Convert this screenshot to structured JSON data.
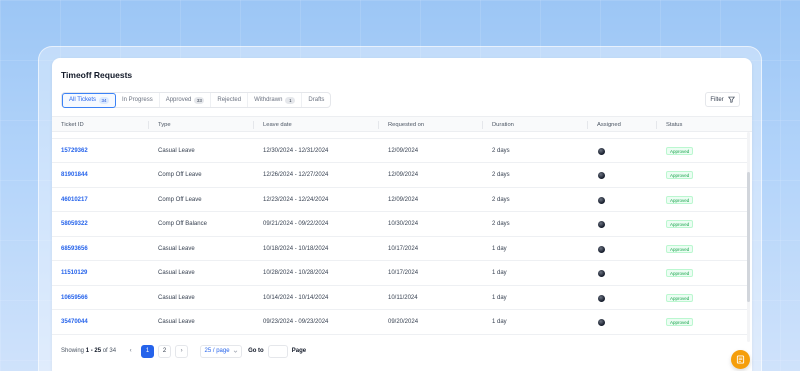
{
  "page": {
    "title": "Timeoff Requests"
  },
  "tabs": [
    {
      "label": "All Tickets",
      "count": "34",
      "active": true
    },
    {
      "label": "In Progress",
      "count": ""
    },
    {
      "label": "Approved",
      "count": "33"
    },
    {
      "label": "Rejected",
      "count": ""
    },
    {
      "label": "Withdrawn",
      "count": "1"
    },
    {
      "label": "Drafts",
      "count": ""
    }
  ],
  "filter": {
    "label": "Filter",
    "icon": "filter-icon"
  },
  "table": {
    "columns": [
      "Ticket ID",
      "Type",
      "Leave date",
      "Requested on",
      "Duration",
      "Assigned",
      "Status"
    ],
    "rows": [
      {
        "id": "15729362",
        "type": "Casual Leave",
        "leave_date": "12/30/2024 - 12/31/2024",
        "requested_on": "12/09/2024",
        "duration": "2 days",
        "status": "Approved"
      },
      {
        "id": "81901844",
        "type": "Comp Off Leave",
        "leave_date": "12/26/2024 - 12/27/2024",
        "requested_on": "12/09/2024",
        "duration": "2 days",
        "status": "Approved"
      },
      {
        "id": "46010217",
        "type": "Comp Off Leave",
        "leave_date": "12/23/2024 - 12/24/2024",
        "requested_on": "12/09/2024",
        "duration": "2 days",
        "status": "Approved"
      },
      {
        "id": "58059322",
        "type": "Comp Off Balance",
        "leave_date": "09/21/2024 - 09/22/2024",
        "requested_on": "10/30/2024",
        "duration": "2 days",
        "status": "Approved"
      },
      {
        "id": "68593656",
        "type": "Casual Leave",
        "leave_date": "10/18/2024 - 10/18/2024",
        "requested_on": "10/17/2024",
        "duration": "1 day",
        "status": "Approved"
      },
      {
        "id": "11510129",
        "type": "Casual Leave",
        "leave_date": "10/28/2024 - 10/28/2024",
        "requested_on": "10/17/2024",
        "duration": "1 day",
        "status": "Approved"
      },
      {
        "id": "10659566",
        "type": "Casual Leave",
        "leave_date": "10/14/2024 - 10/14/2024",
        "requested_on": "10/11/2024",
        "duration": "1 day",
        "status": "Approved"
      },
      {
        "id": "35470044",
        "type": "Casual Leave",
        "leave_date": "09/23/2024 - 09/23/2024",
        "requested_on": "09/20/2024",
        "duration": "1 day",
        "status": "Approved"
      }
    ]
  },
  "pagination": {
    "showing_prefix": "Showing",
    "range": "1 - 25",
    "of_label": "of 34",
    "pages": [
      "1",
      "2"
    ],
    "current": "1",
    "prev_icon": "‹",
    "next_icon": "›",
    "per_page": "25 / page",
    "goto_label": "Go to",
    "page_label": "Page"
  },
  "colors": {
    "accent": "#2563eb",
    "status_approved": "#16a34a",
    "fab": "#f59e0b"
  }
}
